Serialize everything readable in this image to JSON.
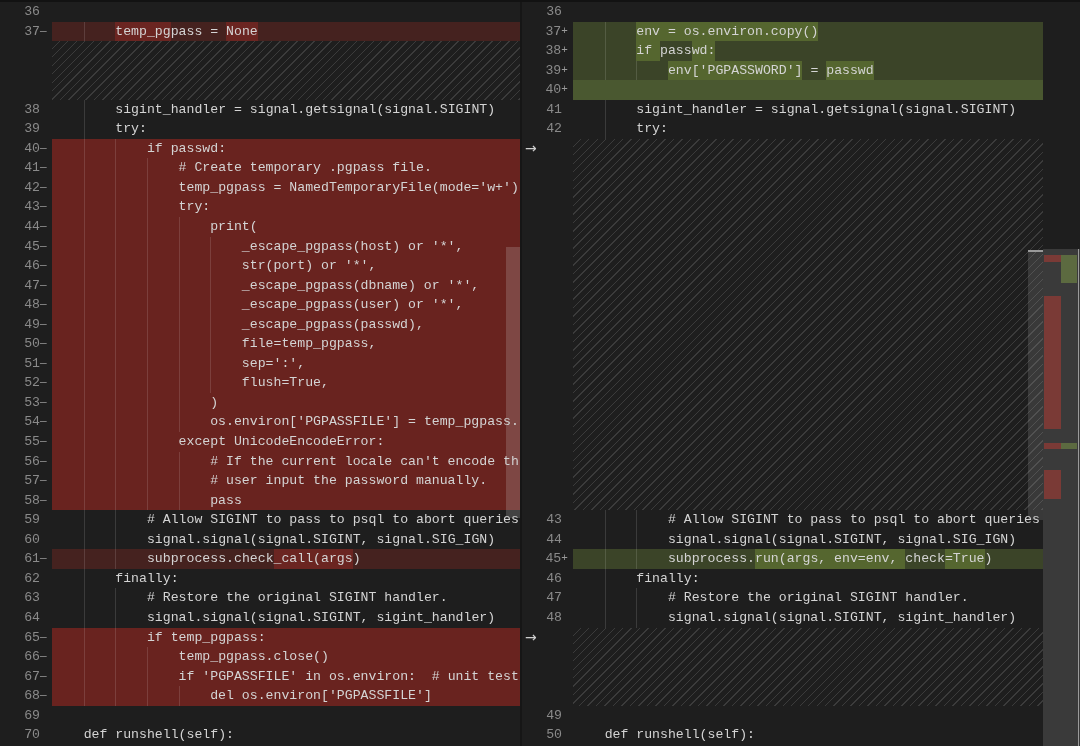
{
  "left_pane": {
    "rows": [
      {
        "kind": "context",
        "number": "36"
      },
      {
        "kind": "removed",
        "number": "37",
        "marker": "—",
        "segments": [
          {
            "text": "        temp_pg",
            "hl": true
          },
          {
            "text": "pass = ",
            "hl": false
          },
          {
            "text": "None",
            "hl": true
          }
        ]
      },
      {
        "kind": "filler"
      },
      {
        "kind": "filler"
      },
      {
        "kind": "filler"
      },
      {
        "kind": "context",
        "number": "38",
        "code": "        sigint_handler = signal.getsignal(signal.SIGINT)"
      },
      {
        "kind": "context",
        "number": "39",
        "code": "        try:"
      },
      {
        "kind": "removed",
        "number": "40",
        "marker": "—",
        "code": "            if passwd:"
      },
      {
        "kind": "removed",
        "number": "41",
        "marker": "—",
        "code": "                # Create temporary .pgpass file."
      },
      {
        "kind": "removed",
        "number": "42",
        "marker": "—",
        "code": "                temp_pgpass = NamedTemporaryFile(mode='w+')"
      },
      {
        "kind": "removed",
        "number": "43",
        "marker": "—",
        "code": "                try:"
      },
      {
        "kind": "removed",
        "number": "44",
        "marker": "—",
        "code": "                    print("
      },
      {
        "kind": "removed",
        "number": "45",
        "marker": "—",
        "code": "                        _escape_pgpass(host) or '*',"
      },
      {
        "kind": "removed",
        "number": "46",
        "marker": "—",
        "code": "                        str(port) or '*',"
      },
      {
        "kind": "removed",
        "number": "47",
        "marker": "—",
        "code": "                        _escape_pgpass(dbname) or '*',"
      },
      {
        "kind": "removed",
        "number": "48",
        "marker": "—",
        "code": "                        _escape_pgpass(user) or '*',"
      },
      {
        "kind": "removed",
        "number": "49",
        "marker": "—",
        "code": "                        _escape_pgpass(passwd),"
      },
      {
        "kind": "removed",
        "number": "50",
        "marker": "—",
        "code": "                        file=temp_pgpass,"
      },
      {
        "kind": "removed",
        "number": "51",
        "marker": "—",
        "code": "                        sep=':',"
      },
      {
        "kind": "removed",
        "number": "52",
        "marker": "—",
        "code": "                        flush=True,"
      },
      {
        "kind": "removed",
        "number": "53",
        "marker": "—",
        "code": "                    )"
      },
      {
        "kind": "removed",
        "number": "54",
        "marker": "—",
        "code": "                    os.environ['PGPASSFILE'] = temp_pgpass."
      },
      {
        "kind": "removed",
        "number": "55",
        "marker": "—",
        "code": "                except UnicodeEncodeError:"
      },
      {
        "kind": "removed",
        "number": "56",
        "marker": "—",
        "code": "                    # If the current locale can't encode th"
      },
      {
        "kind": "removed",
        "number": "57",
        "marker": "—",
        "code": "                    # user input the password manually."
      },
      {
        "kind": "removed",
        "number": "58",
        "marker": "—",
        "code": "                    pass"
      },
      {
        "kind": "context",
        "number": "59",
        "code": "            # Allow SIGINT to pass to psql to abort queries"
      },
      {
        "kind": "context",
        "number": "60",
        "code": "            signal.signal(signal.SIGINT, signal.SIG_IGN)"
      },
      {
        "kind": "removed",
        "number": "61",
        "marker": "—",
        "segments": [
          {
            "text": "            subprocess.check",
            "hl": false
          },
          {
            "text": "_call(args",
            "hl": true
          },
          {
            "text": ")",
            "hl": false
          }
        ]
      },
      {
        "kind": "context",
        "number": "62",
        "code": "        finally:"
      },
      {
        "kind": "context",
        "number": "63",
        "code": "            # Restore the original SIGINT handler."
      },
      {
        "kind": "context",
        "number": "64",
        "code": "            signal.signal(signal.SIGINT, sigint_handler)"
      },
      {
        "kind": "removed",
        "number": "65",
        "marker": "—",
        "code": "            if temp_pgpass:"
      },
      {
        "kind": "removed",
        "number": "66",
        "marker": "—",
        "code": "                temp_pgpass.close()"
      },
      {
        "kind": "removed",
        "number": "67",
        "marker": "—",
        "code": "                if 'PGPASSFILE' in os.environ:  # unit test"
      },
      {
        "kind": "removed",
        "number": "68",
        "marker": "—",
        "code": "                    del os.environ['PGPASSFILE']"
      },
      {
        "kind": "context",
        "number": "69"
      },
      {
        "kind": "context",
        "number": "70",
        "code": "    def runshell(self):"
      }
    ]
  },
  "right_pane": {
    "rows": [
      {
        "kind": "context",
        "number": "36"
      },
      {
        "kind": "added",
        "number": "37",
        "marker": "+",
        "segments": [
          {
            "text": "        env = os.environ.copy()",
            "hl": true
          }
        ]
      },
      {
        "kind": "added",
        "number": "38",
        "marker": "+",
        "segments": [
          {
            "text": "        if ",
            "hl": true
          },
          {
            "text": "pass",
            "hl": false
          },
          {
            "text": "wd:",
            "hl": true
          }
        ]
      },
      {
        "kind": "added",
        "number": "39",
        "marker": "+",
        "segments": [
          {
            "text": "            env['PGPASSWORD']",
            "hl": true
          },
          {
            "text": " = ",
            "hl": false
          },
          {
            "text": "passwd",
            "hl": true
          }
        ]
      },
      {
        "kind": "added",
        "number": "40",
        "marker": "+"
      },
      {
        "kind": "context",
        "number": "41",
        "code": "        sigint_handler = signal.getsignal(signal.SIGINT)"
      },
      {
        "kind": "context",
        "number": "42",
        "code": "        try:"
      },
      {
        "kind": "filler",
        "arrow": "→"
      },
      {
        "kind": "filler"
      },
      {
        "kind": "filler"
      },
      {
        "kind": "filler"
      },
      {
        "kind": "filler"
      },
      {
        "kind": "filler"
      },
      {
        "kind": "filler"
      },
      {
        "kind": "filler"
      },
      {
        "kind": "filler"
      },
      {
        "kind": "filler"
      },
      {
        "kind": "filler"
      },
      {
        "kind": "filler"
      },
      {
        "kind": "filler"
      },
      {
        "kind": "filler"
      },
      {
        "kind": "filler"
      },
      {
        "kind": "filler"
      },
      {
        "kind": "filler"
      },
      {
        "kind": "filler"
      },
      {
        "kind": "filler"
      },
      {
        "kind": "context",
        "number": "43",
        "code": "            # Allow SIGINT to pass to psql to abort queries"
      },
      {
        "kind": "context",
        "number": "44",
        "code": "            signal.signal(signal.SIGINT, signal.SIG_IGN)"
      },
      {
        "kind": "added",
        "number": "45",
        "marker": "+",
        "segments": [
          {
            "text": "            subprocess.",
            "hl": false
          },
          {
            "text": "run(args, env=env, ",
            "hl": true
          },
          {
            "text": "check",
            "hl": false
          },
          {
            "text": "=True",
            "hl": true
          },
          {
            "text": ")",
            "hl": false
          }
        ]
      },
      {
        "kind": "context",
        "number": "46",
        "code": "        finally:"
      },
      {
        "kind": "context",
        "number": "47",
        "code": "            # Restore the original SIGINT handler."
      },
      {
        "kind": "context",
        "number": "48",
        "code": "            signal.signal(signal.SIGINT, sigint_handler)"
      },
      {
        "kind": "filler",
        "arrow": "→"
      },
      {
        "kind": "filler"
      },
      {
        "kind": "filler"
      },
      {
        "kind": "filler"
      },
      {
        "kind": "context",
        "number": "49"
      },
      {
        "kind": "context",
        "number": "50",
        "code": "    def runshell(self):"
      }
    ]
  }
}
